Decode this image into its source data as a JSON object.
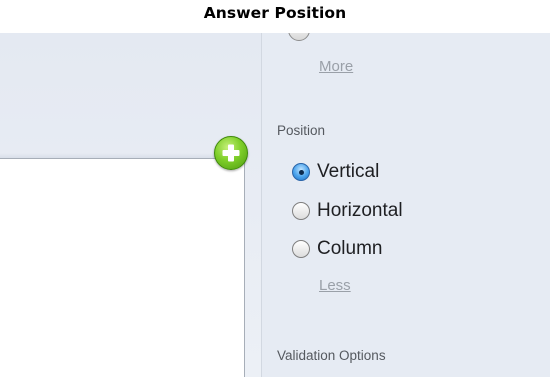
{
  "caption": "Answer Position",
  "options_panel": {
    "more_link": "More",
    "position": {
      "label": "Position",
      "options": [
        {
          "label": "Vertical",
          "selected": true
        },
        {
          "label": "Horizontal",
          "selected": false
        },
        {
          "label": "Column",
          "selected": false
        }
      ],
      "less_link": "Less"
    },
    "validation_label": "Validation Options"
  },
  "add_button": {
    "icon": "plus-icon",
    "color": "#7fcf2a"
  },
  "colors": {
    "panel_bg": "#e6ebf3",
    "selected_radio": "#4aa3ec",
    "link_text": "#9aa0a8"
  }
}
